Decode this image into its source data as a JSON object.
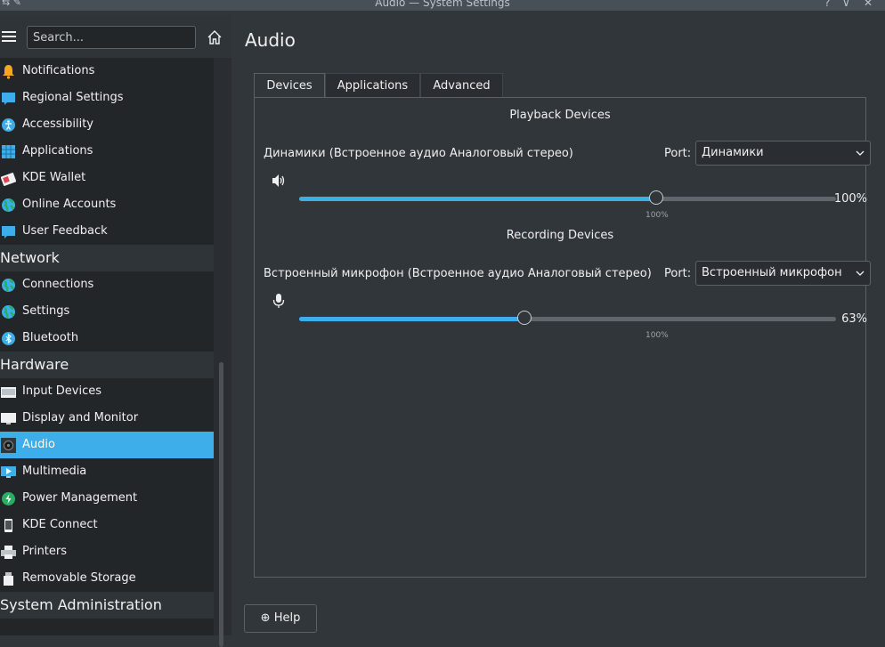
{
  "window": {
    "title": "Audio — System Settings",
    "buttons": [
      "?",
      "∨",
      "✕"
    ]
  },
  "sidebar": {
    "search_placeholder": "Search...",
    "items": [
      {
        "label": "Notifications",
        "icon": "bell-icon"
      },
      {
        "label": "Regional Settings",
        "icon": "regional-settings-icon"
      },
      {
        "label": "Accessibility",
        "icon": "accessibility-icon"
      },
      {
        "label": "Applications",
        "icon": "applications-grid-icon"
      },
      {
        "label": "KDE Wallet",
        "icon": "wallet-icon"
      },
      {
        "label": "Online Accounts",
        "icon": "globe-icon"
      },
      {
        "label": "User Feedback",
        "icon": "feedback-icon"
      }
    ],
    "network": {
      "label": "Network",
      "items": [
        {
          "label": "Connections",
          "icon": "globe-icon"
        },
        {
          "label": "Settings",
          "icon": "globe-icon"
        },
        {
          "label": "Bluetooth",
          "icon": "bluetooth-icon"
        }
      ]
    },
    "hardware": {
      "label": "Hardware",
      "items": [
        {
          "label": "Input Devices",
          "icon": "keyboard-icon"
        },
        {
          "label": "Display and Monitor",
          "icon": "monitor-icon"
        },
        {
          "label": "Audio",
          "icon": "speaker-icon"
        },
        {
          "label": "Multimedia",
          "icon": "multimedia-icon"
        },
        {
          "label": "Power Management",
          "icon": "power-icon"
        },
        {
          "label": "KDE Connect",
          "icon": "phone-icon"
        },
        {
          "label": "Printers",
          "icon": "printer-icon"
        },
        {
          "label": "Removable Storage",
          "icon": "usb-drive-icon"
        }
      ]
    },
    "sysadmin": {
      "label": "System Administration"
    }
  },
  "main": {
    "title": "Audio",
    "tabs": [
      "Devices",
      "Applications",
      "Advanced"
    ],
    "playback": {
      "section_title": "Playback Devices",
      "device_name": "Динамики (Встроенное аудио Аналоговый стерео)",
      "port_label": "Port:",
      "port_value": "Динамики",
      "volume": 100,
      "volume_text": "100%",
      "marker_text": "100%"
    },
    "recording": {
      "section_title": "Recording Devices",
      "device_name": "Встроенный микрофон (Встроенное аудио Аналоговый стерео)",
      "port_label": "Port:",
      "port_value": "Встроенный микрофон",
      "volume": 63,
      "volume_text": "63%",
      "marker_text": "100%"
    },
    "help_label": "Help"
  },
  "colors": {
    "accent": "#3daee9",
    "background": "#31363b",
    "sidebar": "#232629"
  }
}
